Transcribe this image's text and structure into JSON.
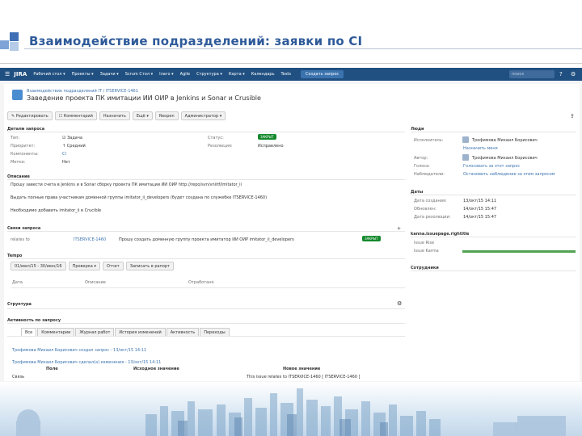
{
  "slide": {
    "title": "Взаимодействие подразделений: заявки по CI",
    "colors": {
      "title": "#2e5a99",
      "nav": "#205081",
      "accent": "#3b73af",
      "status": "#14892c"
    }
  },
  "topnav": {
    "logo": "JIRA",
    "items": [
      "Рабочий стол ▾",
      "Проекты ▾",
      "Задачи ▾",
      "Scrum Стол ▾",
      "Ілаго ▾",
      "Agile",
      "Структура ▾",
      "Карта ▾",
      "Календарь",
      "Tests"
    ],
    "create": "Создать запрос",
    "search_placeholder": "поиск",
    "icons": [
      "help-icon",
      "gear-icon"
    ]
  },
  "issue": {
    "breadcrumb": "Взаимодействие подразделений IT / ITSERVICE-1461",
    "title": "Заведение проекта ПК имитации ИИ ОИР в Jenkins и Sonar и Crusible",
    "toolbar": [
      "✎ Редактировать",
      "☐ Комментарий",
      "Назначить",
      "Ещё ▾",
      "Reopen",
      "Администратор ▾"
    ]
  },
  "details": {
    "heading": "Детали запроса",
    "rows": [
      {
        "label": "Тип:",
        "value": "☑ Задача"
      },
      {
        "label": "Приоритет:",
        "value": "↑ Средний"
      },
      {
        "label": "Компоненты:",
        "value": "CI"
      },
      {
        "label": "Метки:",
        "value": "Нет"
      }
    ],
    "status_label": "Статус:",
    "status_value": "ЗАКРЫТ",
    "resolution_label": "Резолюция:",
    "resolution_value": "Исправлено"
  },
  "description": {
    "heading": "Описание",
    "lines": [
      "Прошу завести счета в Jenkins и в Sonar сборку проекта ПК имитации ИИ ОИР http://repo/svn/vniitf/imitator_ii",
      "Выдать полные права участникам доменной группы imitator_ii_developers (будет создана по служебке ITSERVICE-1460)",
      "Необходимо добавить imitator_ii в Crucible"
    ]
  },
  "links": {
    "heading": "Связи запроса",
    "type": "relates to",
    "key": "ITSERVICE-1460",
    "summary": "Прошу создать доменную группу проекта имитатор ИИ ОИР imitator_ii_developers",
    "status": "ЗАКРЫТ"
  },
  "tempo": {
    "heading": "Tempo",
    "period": "01/июл/15 - 30/июн/16",
    "buttons": [
      "Проверка ▾",
      "Отчет",
      "Записать в рапорт"
    ],
    "columns": [
      "Дата",
      "Описание",
      "Отработано"
    ]
  },
  "structure": {
    "heading": "Структура"
  },
  "activity": {
    "heading": "Активность по запросу",
    "tabs": [
      "Все",
      "Комментарии",
      "Журнал работ",
      "История изменений",
      "Активность",
      "Переходы"
    ],
    "entries": [
      "Трофимова Михаил Борисович создал запрос - 13/окт/15 14:11",
      "Трофимова Михаил Борисович сделал(а) изменения - 13/окт/15 14:11"
    ],
    "change_columns": [
      "Поле",
      "Исходное значение",
      "Новое значение"
    ],
    "change_row": [
      "Связь",
      "",
      "This issue relates to ITSERVICE-1460 [ ITSERVICE-1460 ]"
    ]
  },
  "people": {
    "heading": "Люди",
    "rows": [
      {
        "label": "Исполнитель:",
        "value": "Трофимова Михаил Борисович"
      },
      {
        "label": "",
        "value": "Назначить меня"
      },
      {
        "label": "Автор:",
        "value": "Трофимова Михаил Борисович"
      },
      {
        "label": "Голоса:",
        "value": "Голосовать за этот запрос"
      },
      {
        "label": "Наблюдатели:",
        "value": "Остановить наблюдение за этим запросом"
      }
    ]
  },
  "dates": {
    "heading": "Даты",
    "rows": [
      {
        "label": "Дата создания:",
        "value": "13/окт/15 14:11"
      },
      {
        "label": "Обновлен:",
        "value": "14/окт/15 15:47"
      },
      {
        "label": "Дата резолюции:",
        "value": "14/окт/15 15:47"
      }
    ]
  },
  "panel": {
    "heading": "kanna.issuepage.rightitle",
    "rows": [
      "Issue Rise",
      "Issue Karma"
    ]
  },
  "collaborators": {
    "heading": "Сотрудники"
  }
}
